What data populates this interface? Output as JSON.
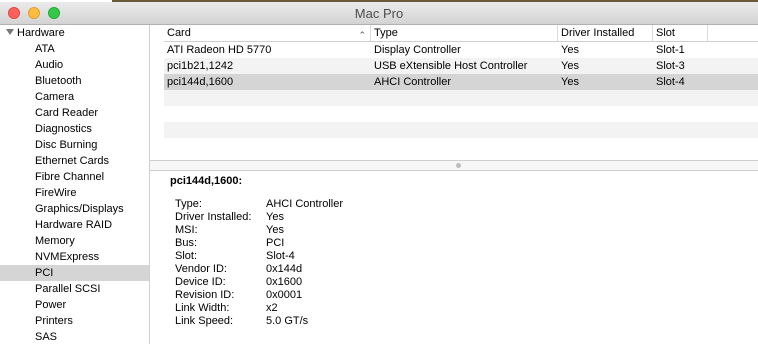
{
  "window": {
    "title": "Mac Pro"
  },
  "sidebar": {
    "group_label": "Hardware",
    "items": [
      {
        "label": "ATA"
      },
      {
        "label": "Audio"
      },
      {
        "label": "Bluetooth"
      },
      {
        "label": "Camera"
      },
      {
        "label": "Card Reader"
      },
      {
        "label": "Diagnostics"
      },
      {
        "label": "Disc Burning"
      },
      {
        "label": "Ethernet Cards"
      },
      {
        "label": "Fibre Channel"
      },
      {
        "label": "FireWire"
      },
      {
        "label": "Graphics/Displays"
      },
      {
        "label": "Hardware RAID"
      },
      {
        "label": "Memory"
      },
      {
        "label": "NVMExpress"
      },
      {
        "label": "PCI"
      },
      {
        "label": "Parallel SCSI"
      },
      {
        "label": "Power"
      },
      {
        "label": "Printers"
      },
      {
        "label": "SAS"
      }
    ],
    "selected": "PCI"
  },
  "table": {
    "columns": [
      "Card",
      "Type",
      "Driver Installed",
      "Slot"
    ],
    "sort_indicator": "⌃",
    "rows": [
      [
        "ATI Radeon HD 5770",
        "Display Controller",
        "Yes",
        "Slot-1"
      ],
      [
        "pci1b21,1242",
        "USB eXtensible Host Controller",
        "Yes",
        "Slot-3"
      ],
      [
        "pci144d,1600",
        "AHCI Controller",
        "Yes",
        "Slot-4"
      ]
    ],
    "selected_row": 2
  },
  "detail": {
    "title": "pci144d,1600:",
    "fields": [
      {
        "key": "Type:",
        "value": "AHCI Controller"
      },
      {
        "key": "Driver Installed:",
        "value": "Yes"
      },
      {
        "key": "MSI:",
        "value": "Yes"
      },
      {
        "key": "Bus:",
        "value": "PCI"
      },
      {
        "key": "Slot:",
        "value": "Slot-4"
      },
      {
        "key": "Vendor ID:",
        "value": "0x144d"
      },
      {
        "key": "Device ID:",
        "value": "0x1600"
      },
      {
        "key": "Revision ID:",
        "value": "0x0001"
      },
      {
        "key": "Link Width:",
        "value": "x2"
      },
      {
        "key": "Link Speed:",
        "value": "5.0 GT/s"
      }
    ]
  }
}
